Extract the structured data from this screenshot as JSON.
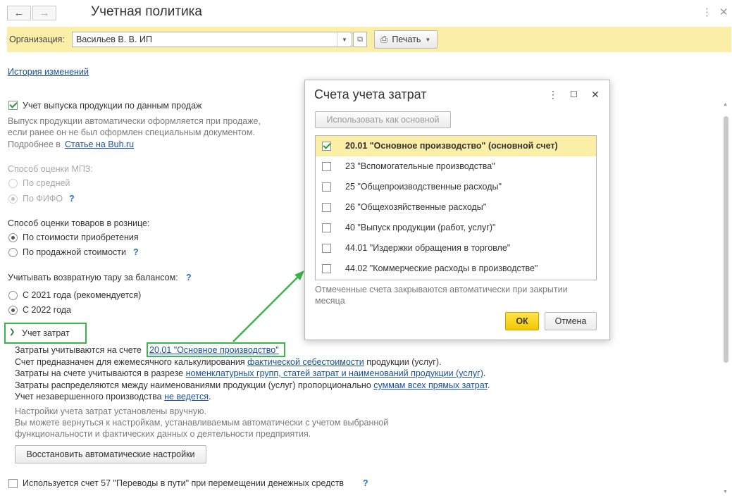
{
  "window": {
    "title": "Учетная политика"
  },
  "org": {
    "label": "Организация:",
    "value": "Васильев В. В. ИП",
    "print_label": "Печать"
  },
  "history_link": "История изменений",
  "production": {
    "checkbox_label": "Учет выпуска продукции по данным продаж",
    "desc_line1": "Выпуск продукции автоматически оформляется при продаже,",
    "desc_line2": "если ранее он не был оформлен специальным документом.",
    "more_prefix": "Подробнее в",
    "more_link": "Статье на Buh.ru"
  },
  "mpz": {
    "label": "Способ оценки МПЗ:",
    "options": [
      "По средней",
      "По ФИФО"
    ]
  },
  "retail": {
    "label": "Способ оценки товаров в рознице:",
    "options": [
      "По стоимости приобретения",
      "По продажной стоимости"
    ]
  },
  "tare": {
    "label": "Учитывать возвратную тару за балансом:",
    "options": [
      "С 2021 года (рекомендуется)",
      "С 2022 года"
    ]
  },
  "costs": {
    "section_title": "Учет затрат",
    "line1_prefix": "Затраты учитываются на счете",
    "line1_link": "20.01 \"Основное производство\"",
    "line2_prefix": "Счет предназначен для ежемесячного калькулирования",
    "line2_link": "фактической себестоимости",
    "line2_suffix": "продукции (услуг).",
    "line3_prefix": "Затраты на счете учитываются в разрезе",
    "line3_link": "номенклатурных групп, статей затрат и наименований продукции (услуг)",
    "line3_suffix": ".",
    "line4_prefix": "Затраты распределяются между наименованиями продукции (услуг) пропорционально",
    "line4_link": "суммам всех прямых затрат",
    "line4_suffix": ".",
    "line5_prefix": "Учет незавершенного производства",
    "line5_link": "не ведется",
    "line5_suffix": ".",
    "note1": "Настройки учета затрат установлены вручную.",
    "note2": "Вы можете вернуться к настройкам, устанавливаемым автоматически с учетом выбранной",
    "note3": "функциональности и фактических данных о деятельности предприятия.",
    "restore_button": "Восстановить автоматические настройки"
  },
  "account57": {
    "label": "Используется счет 57 \"Переводы в пути\" при перемещении денежных средств"
  },
  "help_mark": "?",
  "dialog": {
    "title": "Счета учета затрат",
    "use_as_main": "Использовать как основной",
    "accounts": [
      {
        "label": "20.01 \"Основное производство\" (основной счет)",
        "checked": true,
        "selected": true
      },
      {
        "label": "23 \"Вспомогательные производства\"",
        "checked": false
      },
      {
        "label": "25 \"Общепроизводственные расходы\"",
        "checked": false
      },
      {
        "label": "26 \"Общехозяйственные расходы\"",
        "checked": false
      },
      {
        "label": "40 \"Выпуск продукции (работ, услуг)\"",
        "checked": false
      },
      {
        "label": "44.01 \"Издержки обращения в торговле\"",
        "checked": false
      },
      {
        "label": "44.02 \"Коммерческие расходы в производстве\"",
        "checked": false
      }
    ],
    "note_line1": "Отмеченные счета закрываются автоматически при закрытии",
    "note_line2": "месяца",
    "ok": "ОК",
    "cancel": "Отмена"
  },
  "colors": {
    "highlight": "#3bb54a",
    "yellow_bar": "#fbeea7",
    "ok_button": "#f4c700",
    "link": "#1a4f9c"
  }
}
